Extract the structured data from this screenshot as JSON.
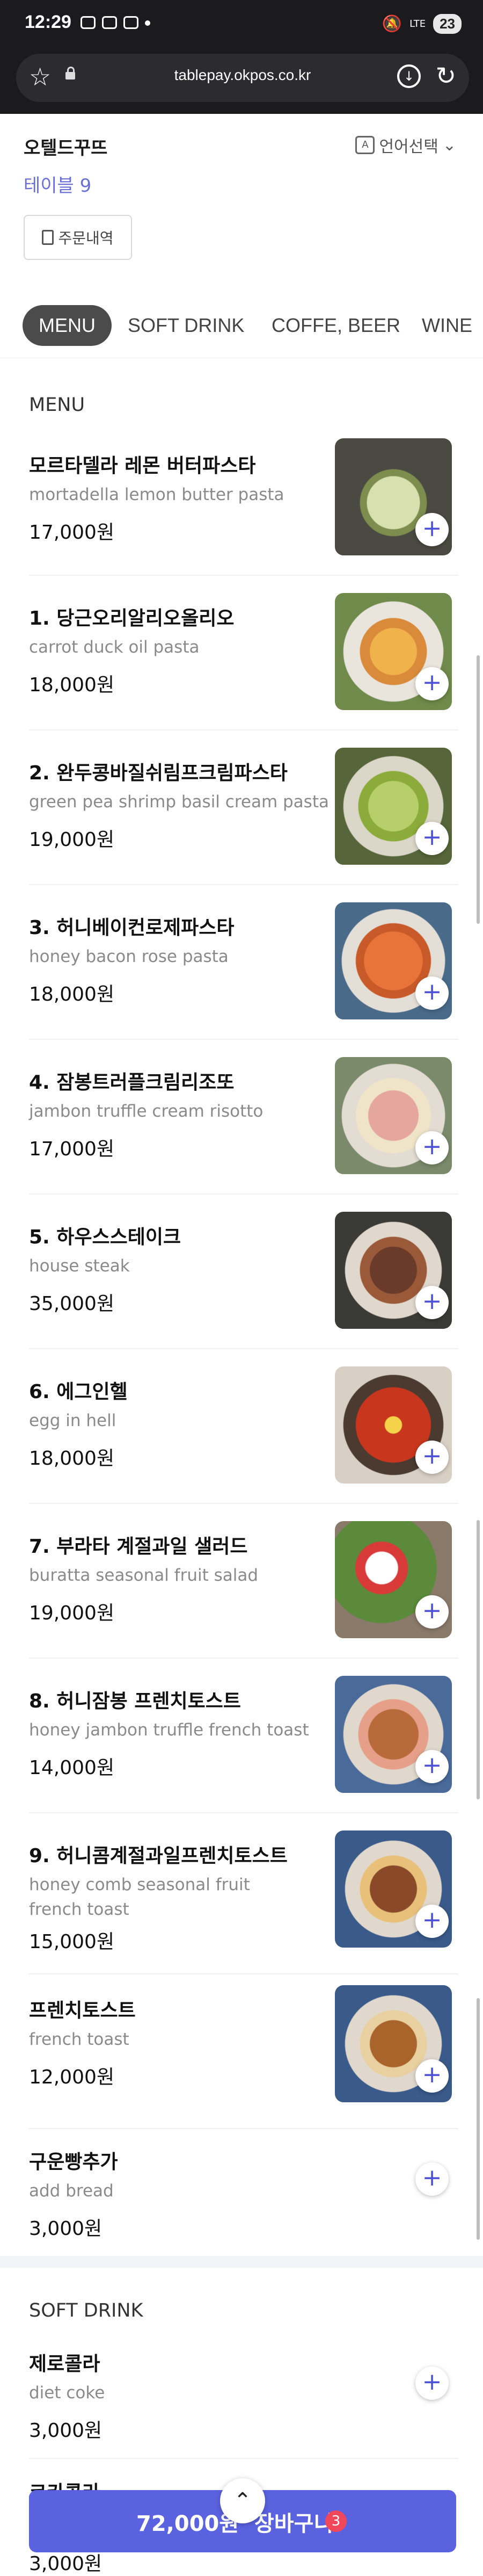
{
  "statusbar": {
    "time": "12:29",
    "battery": "23",
    "signal": "LTE"
  },
  "browser": {
    "url": "tablepay.okpos.co.kr"
  },
  "header": {
    "store_name": "오텔드꾸뜨",
    "table": "테이블 9",
    "language": "언어선택",
    "order_history": "주문내역"
  },
  "tabs": [
    {
      "label": "MENU",
      "active": true
    },
    {
      "label": "SOFT DRINK",
      "active": false
    },
    {
      "label": "COFFE, BEER",
      "active": false
    },
    {
      "label": "WINE",
      "active": false
    }
  ],
  "menu_section": {
    "title": "MENU",
    "items": [
      {
        "name": "모르타델라 레몬 버터파스타",
        "en": "mortadella lemon butter pasta",
        "price": "17,000원"
      },
      {
        "name": "1. 당근오리알리오올리오",
        "en": "carrot duck oil pasta",
        "price": "18,000원"
      },
      {
        "name": "2. 완두콩바질쉬림프크림파스타",
        "en": "green pea shrimp basil cream pasta",
        "price": "19,000원"
      },
      {
        "name": "3. 허니베이컨로제파스타",
        "en": "honey bacon rose pasta",
        "price": "18,000원"
      },
      {
        "name": "4. 잠봉트러플크림리조또",
        "en": "jambon truffle cream risotto",
        "price": "17,000원"
      },
      {
        "name": "5. 하우스스테이크",
        "en": "house steak",
        "price": "35,000원"
      },
      {
        "name": "6. 에그인헬",
        "en": "egg in hell",
        "price": "18,000원"
      },
      {
        "name": "7. 부라타 계절과일 샐러드",
        "en": "buratta seasonal fruit salad",
        "price": "19,000원"
      },
      {
        "name": "8. 허니잠봉 프렌치토스트",
        "en": "honey jambon truffle french toast",
        "price": "14,000원"
      },
      {
        "name": "9. 허니콤계절과일프렌치토스트",
        "en": "honey comb seasonal fruit french toast",
        "price": "15,000원"
      },
      {
        "name": "프렌치토스트",
        "en": "french toast",
        "price": "12,000원"
      },
      {
        "name": "구운빵추가",
        "en": "add bread",
        "price": "3,000원"
      }
    ]
  },
  "soft_drink_section": {
    "title": "SOFT DRINK",
    "items": [
      {
        "name": "제로콜라",
        "en": "diet coke",
        "price": "3,000원"
      },
      {
        "name": "코카콜라",
        "en": "",
        "price": "3,000원"
      }
    ]
  },
  "cart": {
    "total": "72,000원",
    "label": "장바구니",
    "count": "3"
  },
  "colors": {
    "accent": "#5a62e0",
    "table_text": "#6a6fd6",
    "badge": "#f0475a"
  }
}
